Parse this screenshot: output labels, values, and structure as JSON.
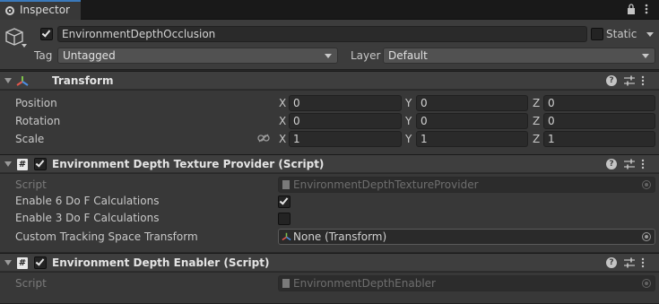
{
  "tab": {
    "label": "Inspector",
    "icon": "info-icon"
  },
  "window_icons": [
    "lock-icon",
    "kebab-menu-icon"
  ],
  "header": {
    "object_name": "EnvironmentDepthOcclusion",
    "active": true,
    "static_label": "Static",
    "static_checked": false,
    "tag_label": "Tag",
    "tag_value": "Untagged",
    "layer_label": "Layer",
    "layer_value": "Default"
  },
  "transform": {
    "title": "Transform",
    "rows": [
      {
        "label": "Position",
        "x": "0",
        "y": "0",
        "z": "0"
      },
      {
        "label": "Rotation",
        "x": "0",
        "y": "0",
        "z": "0"
      },
      {
        "label": "Scale",
        "x": "1",
        "y": "1",
        "z": "1"
      }
    ],
    "axes": {
      "x": "X",
      "y": "Y",
      "z": "Z"
    }
  },
  "provider": {
    "title": "Environment Depth Texture Provider (Script)",
    "enabled": true,
    "script_label": "Script",
    "script_value": "EnvironmentDepthTextureProvider",
    "enable6dof_label": "Enable 6 Do F Calculations",
    "enable6dof_checked": true,
    "enable3dof_label": "Enable 3 Do F Calculations",
    "enable3dof_checked": false,
    "tracking_label": "Custom Tracking Space Transform",
    "tracking_value": "None (Transform)"
  },
  "enabler": {
    "title": "Environment Depth Enabler (Script)",
    "enabled": true,
    "script_label": "Script",
    "script_value": "EnvironmentDepthEnabler"
  },
  "colors": {
    "background": "#383838",
    "header": "#3e3e3e",
    "field": "#2a2a2a",
    "accent": "#3a79bb"
  }
}
